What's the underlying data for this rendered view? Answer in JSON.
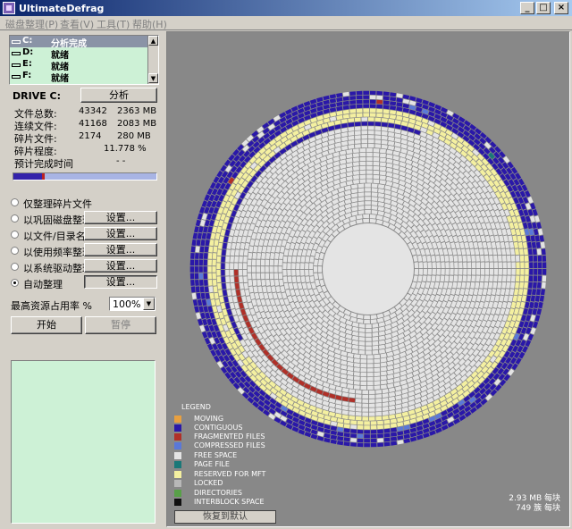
{
  "window": {
    "title": "UltimateDefrag"
  },
  "menu": [
    "磁盘整理(P)",
    "查看(V)",
    "工具(T)",
    "帮助(H)"
  ],
  "drives": [
    {
      "name": "C:",
      "status": "分析完成",
      "selected": true
    },
    {
      "name": "D:",
      "status": "就绪"
    },
    {
      "name": "E:",
      "status": "就绪"
    },
    {
      "name": "F:",
      "status": "就绪"
    }
  ],
  "drive_info": {
    "label": "DRIVE C:",
    "analyze_button": "分析",
    "stats": [
      {
        "label": "文件总数:",
        "count": "43342",
        "size": "2363 MB"
      },
      {
        "label": "连续文件:",
        "count": "41168",
        "size": "2083 MB"
      },
      {
        "label": "碎片文件:",
        "count": "2174",
        "size": "280 MB"
      }
    ],
    "frag_label": "碎片程度:",
    "frag_value": "11.778 %",
    "eta_label": "预计完成时间",
    "eta_value": "- -",
    "progress_fraction": 0.2
  },
  "modes": [
    {
      "label": "仅整理碎片文件",
      "button": ""
    },
    {
      "label": "以巩固磁盘整理",
      "button": "设置..."
    },
    {
      "label": "以文件/目录名整理",
      "button": "设置..."
    },
    {
      "label": "以使用频率整理",
      "button": "设置..."
    },
    {
      "label": "以系统驱动整理",
      "button": "设置..."
    },
    {
      "label": "自动整理",
      "button": "设置...",
      "selected": true
    }
  ],
  "resource": {
    "label": "最高资源占用率 %",
    "value": "100%"
  },
  "actions": {
    "start": "开始",
    "pause": "暂停"
  },
  "legend": {
    "title": "LEGEND",
    "items": [
      {
        "label": "MOVING",
        "color": "#e8a040"
      },
      {
        "label": "CONTIGUOUS",
        "color": "#2a18a8"
      },
      {
        "label": "FRAGMENTED FILES",
        "color": "#b03028"
      },
      {
        "label": "COMPRESSED FILES",
        "color": "#5a78d8"
      },
      {
        "label": "FREE SPACE",
        "color": "#e4e4e4"
      },
      {
        "label": "PAGE FILE",
        "color": "#1a7878"
      },
      {
        "label": "RESERVED FOR MFT",
        "color": "#f4f0a0"
      },
      {
        "label": "LOCKED",
        "color": "#b8b8b8"
      },
      {
        "label": "DIRECTORIES",
        "color": "#58a048"
      },
      {
        "label": "INTERBLOCK SPACE",
        "color": "#101010"
      }
    ]
  },
  "map_stats": {
    "per_block": "2.93 MB 每块",
    "clusters": "749 簇 每块"
  },
  "restore_button": "恢复到默认"
}
